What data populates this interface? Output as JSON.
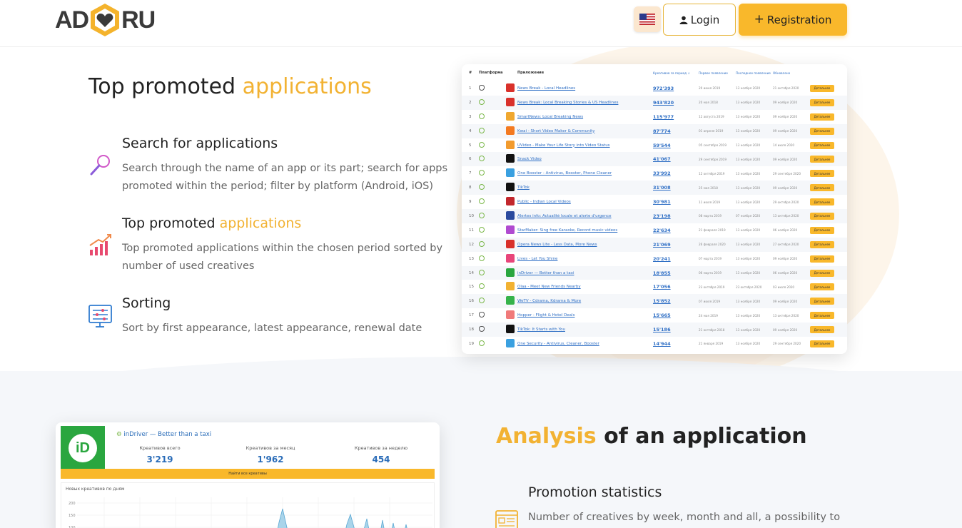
{
  "header": {
    "logo_left": "AD",
    "logo_right": "RU",
    "login_label": "Login",
    "registration_label": "Registration"
  },
  "section1": {
    "title_main": "Top promoted",
    "title_accent": "applications",
    "features": [
      {
        "title": "Search for applications",
        "title_accent": "",
        "text": "Search through the name of an app or its part; search for apps promoted within the period; filter by platform (Android, iOS)"
      },
      {
        "title": "Top promoted",
        "title_accent": "applications",
        "text": "Top promoted applications within the chosen period sorted by number of used creatives"
      },
      {
        "title": "Sorting",
        "title_accent": "",
        "text": "Sort by first appearance, latest appearance, renewal date"
      }
    ],
    "table": {
      "headers": [
        "#",
        "Платформа",
        "Приложение",
        "Креативов за период ↓",
        "Первое появление",
        "Последнее появление",
        "Обновлено"
      ],
      "button_label": "Детальнее",
      "rows": [
        {
          "n": "1",
          "platform": "ios",
          "name": "News Break - Local Headlines",
          "count": "972'393",
          "d1": "20 июня 2019",
          "d2": "13 ноября 2020",
          "d3": "21 октября 2020",
          "color": "#d9312b"
        },
        {
          "n": "2",
          "platform": "android",
          "name": "News Break: Local Breaking Stories & US Headlines",
          "count": "943'820",
          "d1": "20 мая 2018",
          "d2": "13 ноября 2020",
          "d3": "09 ноября 2020",
          "color": "#d9312b"
        },
        {
          "n": "3",
          "platform": "android",
          "name": "SmartNews: Local Breaking News",
          "count": "115'977",
          "d1": "12 августа 2019",
          "d2": "13 ноября 2020",
          "d3": "09 ноября 2020",
          "color": "#f0a830"
        },
        {
          "n": "4",
          "platform": "android",
          "name": "Kwai - Short Video Maker & Community",
          "count": "87'774",
          "d1": "01 апреля 2019",
          "d2": "13 ноября 2020",
          "d3": "09 ноября 2020",
          "color": "#f47a20"
        },
        {
          "n": "5",
          "platform": "android",
          "name": "UVideo - Make Your Life Story into Video Status",
          "count": "59'544",
          "d1": "05 сентября 2019",
          "d2": "13 ноября 2020",
          "d3": "14 июля 2020",
          "color": "#f29b2e"
        },
        {
          "n": "6",
          "platform": "android",
          "name": "Snack Video",
          "count": "41'067",
          "d1": "29 сентября 2019",
          "d2": "13 ноября 2020",
          "d3": "09 ноября 2020",
          "color": "#111111"
        },
        {
          "n": "7",
          "platform": "android",
          "name": "One Booster - Antivirus, Booster, Phone Cleaner",
          "count": "33'992",
          "d1": "12 октября 2019",
          "d2": "13 ноября 2020",
          "d3": "29 сентября 2020",
          "color": "#3aa0e0"
        },
        {
          "n": "8",
          "platform": "android",
          "name": "TikTok",
          "count": "31'008",
          "d1": "25 мая 2018",
          "d2": "13 ноября 2020",
          "d3": "09 ноября 2020",
          "color": "#111111"
        },
        {
          "n": "9",
          "platform": "android",
          "name": "Public - Indian Local Videos",
          "count": "30'981",
          "d1": "11 июля 2019",
          "d2": "13 ноября 2020",
          "d3": "29 октября 2020",
          "color": "#c2272d"
        },
        {
          "n": "10",
          "platform": "android",
          "name": "Alertes info: Actualité locale et alerte d'urgence",
          "count": "23'198",
          "d1": "08 марта 2019",
          "d2": "07 ноября 2020",
          "d3": "13 октября 2020",
          "color": "#2b4a9e"
        },
        {
          "n": "11",
          "platform": "android",
          "name": "StarMaker: Sing free Karaoke, Record music videos",
          "count": "22'634",
          "d1": "21 февраля 2019",
          "d2": "13 ноября 2020",
          "d3": "06 ноября 2020",
          "color": "#b04ad0"
        },
        {
          "n": "12",
          "platform": "android",
          "name": "Opera News Lite - Less Data, More News",
          "count": "21'069",
          "d1": "26 февраля 2020",
          "d2": "13 ноября 2020",
          "d3": "27 октября 2020",
          "color": "#d9312b"
        },
        {
          "n": "13",
          "platform": "android",
          "name": "Lives - Let You Shine",
          "count": "20'241",
          "d1": "07 марта 2019",
          "d2": "13 ноября 2020",
          "d3": "09 ноября 2020",
          "color": "#e8457a"
        },
        {
          "n": "14",
          "platform": "android",
          "name": "inDriver — Better than a taxi",
          "count": "18'855",
          "d1": "06 марта 2019",
          "d2": "13 ноября 2020",
          "d3": "06 ноября 2020",
          "color": "#2aa63f"
        },
        {
          "n": "15",
          "platform": "android",
          "name": "Olaa - Meet New Friends Nearby",
          "count": "17'056",
          "d1": "23 октября 2019",
          "d2": "23 октября 2020",
          "d3": "03 июля 2020",
          "color": "#f2b232"
        },
        {
          "n": "16",
          "platform": "android",
          "name": "WeTV - Cdrama, Kdrama & More",
          "count": "15'852",
          "d1": "07 июля 2019",
          "d2": "13 ноября 2020",
          "d3": "09 ноября 2020",
          "color": "#36b34a"
        },
        {
          "n": "17",
          "platform": "ios",
          "name": "Hopper - Flight & Hotel Deals",
          "count": "15'665",
          "d1": "24 мая 2019",
          "d2": "13 ноября 2020",
          "d3": "13 октября 2020",
          "color": "#f07a7a"
        },
        {
          "n": "18",
          "platform": "ios",
          "name": "TikTok: It Starts with You",
          "count": "15'186",
          "d1": "21 октября 2018",
          "d2": "13 ноября 2020",
          "d3": "09 ноября 2020",
          "color": "#111111"
        },
        {
          "n": "19",
          "platform": "android",
          "name": "One Security - Antivirus, Cleaner, Booster",
          "count": "14'944",
          "d1": "21 января 2019",
          "d2": "13 ноября 2020",
          "d3": "29 сентября 2020",
          "color": "#3aa0e0"
        }
      ]
    }
  },
  "section2": {
    "title_accent": "Analysis",
    "title_main": "of an application",
    "feature": {
      "title": "Promotion statistics",
      "text": "Number of creatives by week, month and all, a possibility to"
    },
    "app_card": {
      "logo_letters": "iD",
      "app_name": "inDriver — Better than a taxi",
      "stats": [
        {
          "label": "Креативов всего",
          "value": "3'219"
        },
        {
          "label": "Креативов за месяц",
          "value": "1'962"
        },
        {
          "label": "Креативов за неделю",
          "value": "454"
        }
      ],
      "bar_label": "Найти все креативы",
      "chart_title": "Новых креативов по дням",
      "y_ticks": [
        "200",
        "150",
        "100"
      ]
    }
  }
}
